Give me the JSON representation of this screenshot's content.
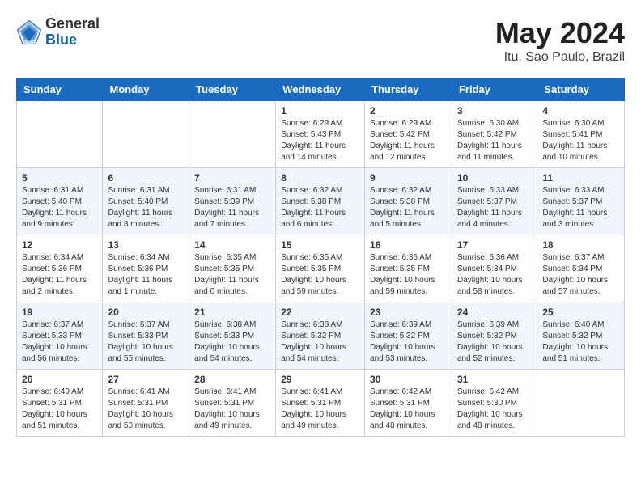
{
  "header": {
    "logo_general": "General",
    "logo_blue": "Blue",
    "month_year": "May 2024",
    "location": "Itu, Sao Paulo, Brazil"
  },
  "weekdays": [
    "Sunday",
    "Monday",
    "Tuesday",
    "Wednesday",
    "Thursday",
    "Friday",
    "Saturday"
  ],
  "weeks": [
    [
      {
        "day": "",
        "info": ""
      },
      {
        "day": "",
        "info": ""
      },
      {
        "day": "",
        "info": ""
      },
      {
        "day": "1",
        "info": "Sunrise: 6:29 AM\nSunset: 5:43 PM\nDaylight: 11 hours\nand 14 minutes."
      },
      {
        "day": "2",
        "info": "Sunrise: 6:29 AM\nSunset: 5:42 PM\nDaylight: 11 hours\nand 12 minutes."
      },
      {
        "day": "3",
        "info": "Sunrise: 6:30 AM\nSunset: 5:42 PM\nDaylight: 11 hours\nand 11 minutes."
      },
      {
        "day": "4",
        "info": "Sunrise: 6:30 AM\nSunset: 5:41 PM\nDaylight: 11 hours\nand 10 minutes."
      }
    ],
    [
      {
        "day": "5",
        "info": "Sunrise: 6:31 AM\nSunset: 5:40 PM\nDaylight: 11 hours\nand 9 minutes."
      },
      {
        "day": "6",
        "info": "Sunrise: 6:31 AM\nSunset: 5:40 PM\nDaylight: 11 hours\nand 8 minutes."
      },
      {
        "day": "7",
        "info": "Sunrise: 6:31 AM\nSunset: 5:39 PM\nDaylight: 11 hours\nand 7 minutes."
      },
      {
        "day": "8",
        "info": "Sunrise: 6:32 AM\nSunset: 5:38 PM\nDaylight: 11 hours\nand 6 minutes."
      },
      {
        "day": "9",
        "info": "Sunrise: 6:32 AM\nSunset: 5:38 PM\nDaylight: 11 hours\nand 5 minutes."
      },
      {
        "day": "10",
        "info": "Sunrise: 6:33 AM\nSunset: 5:37 PM\nDaylight: 11 hours\nand 4 minutes."
      },
      {
        "day": "11",
        "info": "Sunrise: 6:33 AM\nSunset: 5:37 PM\nDaylight: 11 hours\nand 3 minutes."
      }
    ],
    [
      {
        "day": "12",
        "info": "Sunrise: 6:34 AM\nSunset: 5:36 PM\nDaylight: 11 hours\nand 2 minutes."
      },
      {
        "day": "13",
        "info": "Sunrise: 6:34 AM\nSunset: 5:36 PM\nDaylight: 11 hours\nand 1 minute."
      },
      {
        "day": "14",
        "info": "Sunrise: 6:35 AM\nSunset: 5:35 PM\nDaylight: 11 hours\nand 0 minutes."
      },
      {
        "day": "15",
        "info": "Sunrise: 6:35 AM\nSunset: 5:35 PM\nDaylight: 10 hours\nand 59 minutes."
      },
      {
        "day": "16",
        "info": "Sunrise: 6:36 AM\nSunset: 5:35 PM\nDaylight: 10 hours\nand 59 minutes."
      },
      {
        "day": "17",
        "info": "Sunrise: 6:36 AM\nSunset: 5:34 PM\nDaylight: 10 hours\nand 58 minutes."
      },
      {
        "day": "18",
        "info": "Sunrise: 6:37 AM\nSunset: 5:34 PM\nDaylight: 10 hours\nand 57 minutes."
      }
    ],
    [
      {
        "day": "19",
        "info": "Sunrise: 6:37 AM\nSunset: 5:33 PM\nDaylight: 10 hours\nand 56 minutes."
      },
      {
        "day": "20",
        "info": "Sunrise: 6:37 AM\nSunset: 5:33 PM\nDaylight: 10 hours\nand 55 minutes."
      },
      {
        "day": "21",
        "info": "Sunrise: 6:38 AM\nSunset: 5:33 PM\nDaylight: 10 hours\nand 54 minutes."
      },
      {
        "day": "22",
        "info": "Sunrise: 6:38 AM\nSunset: 5:32 PM\nDaylight: 10 hours\nand 54 minutes."
      },
      {
        "day": "23",
        "info": "Sunrise: 6:39 AM\nSunset: 5:32 PM\nDaylight: 10 hours\nand 53 minutes."
      },
      {
        "day": "24",
        "info": "Sunrise: 6:39 AM\nSunset: 5:32 PM\nDaylight: 10 hours\nand 52 minutes."
      },
      {
        "day": "25",
        "info": "Sunrise: 6:40 AM\nSunset: 5:32 PM\nDaylight: 10 hours\nand 51 minutes."
      }
    ],
    [
      {
        "day": "26",
        "info": "Sunrise: 6:40 AM\nSunset: 5:31 PM\nDaylight: 10 hours\nand 51 minutes."
      },
      {
        "day": "27",
        "info": "Sunrise: 6:41 AM\nSunset: 5:31 PM\nDaylight: 10 hours\nand 50 minutes."
      },
      {
        "day": "28",
        "info": "Sunrise: 6:41 AM\nSunset: 5:31 PM\nDaylight: 10 hours\nand 49 minutes."
      },
      {
        "day": "29",
        "info": "Sunrise: 6:41 AM\nSunset: 5:31 PM\nDaylight: 10 hours\nand 49 minutes."
      },
      {
        "day": "30",
        "info": "Sunrise: 6:42 AM\nSunset: 5:31 PM\nDaylight: 10 hours\nand 48 minutes."
      },
      {
        "day": "31",
        "info": "Sunrise: 6:42 AM\nSunset: 5:30 PM\nDaylight: 10 hours\nand 48 minutes."
      },
      {
        "day": "",
        "info": ""
      }
    ]
  ]
}
